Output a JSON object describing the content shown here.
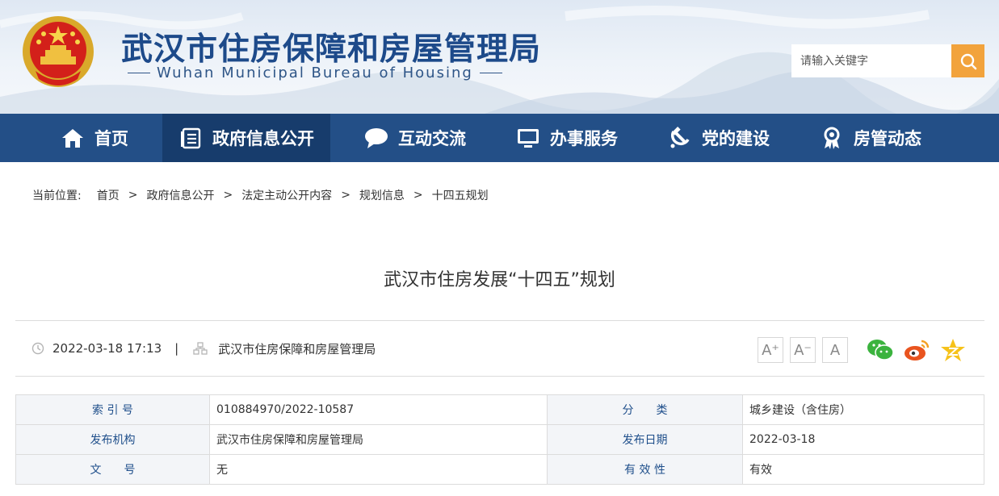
{
  "header": {
    "title": "武汉市住房保障和房屋管理局",
    "subtitle": "Wuhan Municipal Bureau of Housing",
    "emblem_icon": "national-emblem-icon",
    "search_placeholder": "请输入关键字",
    "search_icon": "search-icon"
  },
  "nav": {
    "items": [
      {
        "label": "首页",
        "icon": "home-icon"
      },
      {
        "label": "政府信息公开",
        "icon": "document-list-icon"
      },
      {
        "label": "互动交流",
        "icon": "chat-bubble-icon"
      },
      {
        "label": "办事服务",
        "icon": "monitor-icon"
      },
      {
        "label": "党的建设",
        "icon": "hammer-sickle-icon"
      },
      {
        "label": "房管动态",
        "icon": "award-medal-icon"
      }
    ],
    "active_index": 1
  },
  "breadcrumb": {
    "label": "当前位置:",
    "items": [
      "首页",
      "政府信息公开",
      "法定主动公开内容",
      "规划信息",
      "十四五规划"
    ],
    "separator": ">"
  },
  "article": {
    "title": "武汉市住房发展“十四五”规划",
    "datetime": "2022-03-18 17:13",
    "divider": "|",
    "source": "武汉市住房保障和房屋管理局",
    "font_buttons": [
      "A⁺",
      "A⁻",
      "A"
    ],
    "share_icons": [
      "wechat-icon",
      "weibo-icon",
      "qzone-star-icon"
    ]
  },
  "info_table": {
    "rows": [
      {
        "k1": "索 引 号",
        "v1": "010884970/2022-10587",
        "k2": "分　　类",
        "v2": "城乡建设（含住房）"
      },
      {
        "k1": "发布机构",
        "v1": "武汉市住房保障和房屋管理局",
        "k2": "发布日期",
        "v2": "2022-03-18"
      },
      {
        "k1": "文　　号",
        "v1": "无",
        "k2": "有 效 性",
        "v2": "有效"
      }
    ]
  },
  "colors": {
    "nav_bg": "#234f87",
    "nav_active": "#173c6c",
    "title_blue": "#1d4a8a",
    "search_button": "#f2a33c",
    "key_text": "#1f4f8b"
  }
}
